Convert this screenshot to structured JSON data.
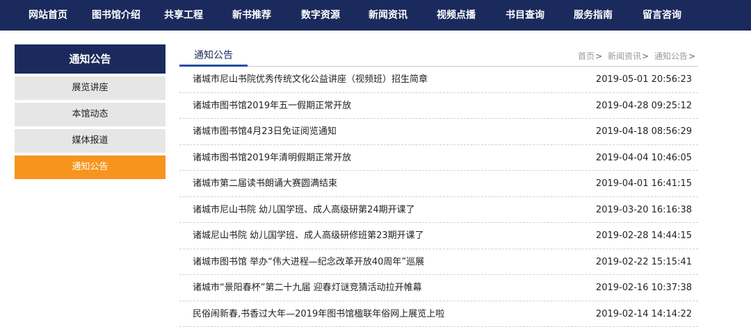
{
  "topnav": {
    "items": [
      "网站首页",
      "图书馆介绍",
      "共享工程",
      "新书推荐",
      "数字资源",
      "新闻资讯",
      "视频点播",
      "书目查询",
      "服务指南",
      "留言咨询"
    ]
  },
  "sidebar": {
    "title": "通知公告",
    "items": [
      "展览讲座",
      "本馆动态",
      "媒体报道",
      "通知公告"
    ],
    "active_index": 3
  },
  "main": {
    "title": "通知公告",
    "breadcrumb": [
      "首页",
      "新闻资讯",
      "通知公告"
    ],
    "news": [
      {
        "title": "诸城市尼山书院优秀传统文化公益讲座（视频班）招生简章",
        "date": "2019-05-01 20:56:23"
      },
      {
        "title": "诸城市图书馆2019年五一假期正常开放",
        "date": "2019-04-28 09:25:12"
      },
      {
        "title": "诸城市图书馆4月23日免证阅览通知",
        "date": "2019-04-18 08:56:29"
      },
      {
        "title": "诸城市图书馆2019年清明假期正常开放",
        "date": "2019-04-04 10:46:05"
      },
      {
        "title": "诸城市第二届读书朗诵大赛圆满结束",
        "date": "2019-04-01 16:41:15"
      },
      {
        "title": "诸城市尼山书院 幼儿国学班、成人高级研第24期开课了",
        "date": "2019-03-20 16:16:38"
      },
      {
        "title": "诸城尼山书院 幼儿国学班、成人高级研修班第23期开课了",
        "date": "2019-02-28 14:44:15"
      },
      {
        "title": "诸城市图书馆 举办“伟大进程—纪念改革开放40周年”巡展",
        "date": "2019-02-22 15:15:41"
      },
      {
        "title": "诸城市“景阳春杯”第二十九届 迎春灯谜竞猜活动拉开帷幕",
        "date": "2019-02-16 10:37:38"
      },
      {
        "title": "民俗闹新春,书香过大年—2019年图书馆楹联年俗网上展览上啦",
        "date": "2019-02-14 14:14:22"
      }
    ]
  },
  "colors": {
    "nav_bg": "#1b2a5c",
    "active_orange": "#f7941d",
    "title_underline": "#2a4aa8",
    "side_item_bg": "#e6e6e6"
  }
}
